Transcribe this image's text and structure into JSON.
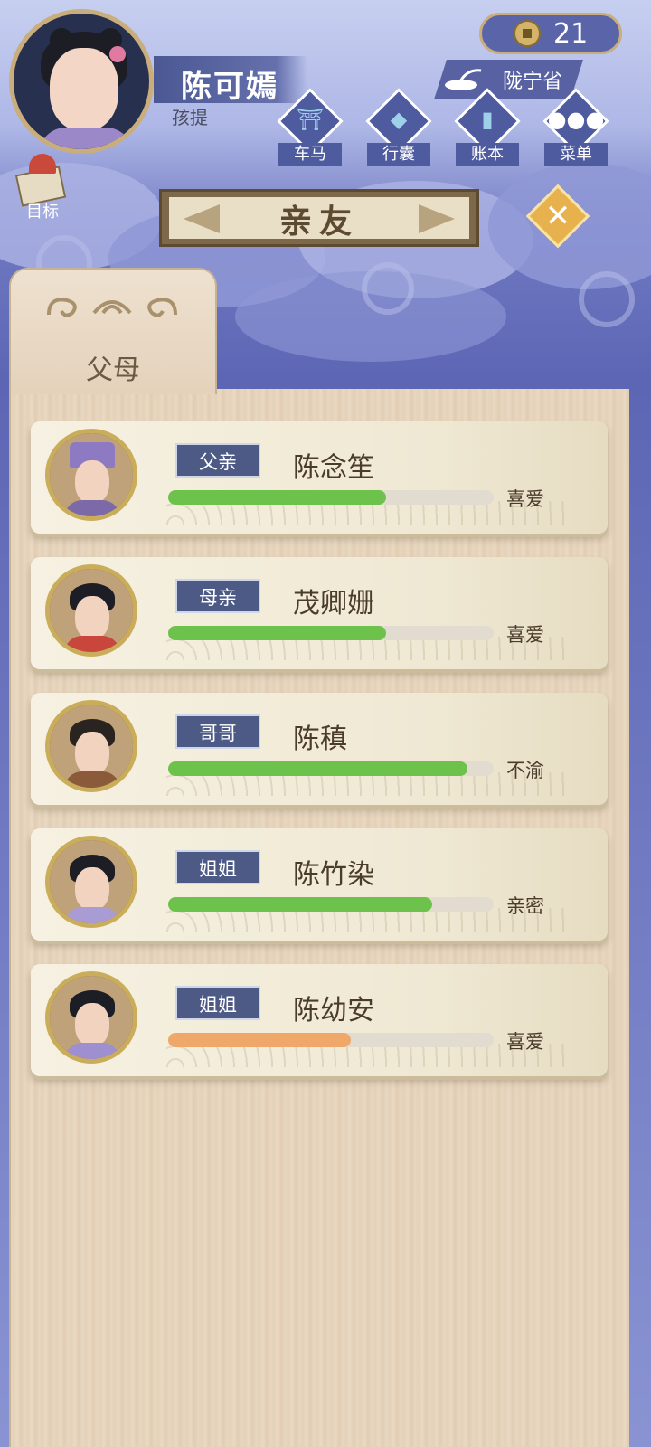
{
  "player": {
    "name": "陈可嫣",
    "title": "孩提"
  },
  "coins": "21",
  "location": "陇宁省",
  "nav": [
    {
      "label": "车马",
      "icon": "carriage-icon"
    },
    {
      "label": "行囊",
      "icon": "bag-icon"
    },
    {
      "label": "账本",
      "icon": "ledger-icon"
    },
    {
      "label": "菜单",
      "icon": "menu-dots-icon"
    }
  ],
  "goal_label": "目标",
  "page_title": "亲友",
  "tab_label": "父母",
  "colors": {
    "bar_green": "#6cc24a",
    "bar_orange": "#f0a86a",
    "relation_tag": "#4d5a86"
  },
  "relatives": [
    {
      "relation": "父亲",
      "name": "陈念笙",
      "mood": "喜爱",
      "affinity": 0.67,
      "bar": "green"
    },
    {
      "relation": "母亲",
      "name": "茂卿姗",
      "mood": "喜爱",
      "affinity": 0.67,
      "bar": "green"
    },
    {
      "relation": "哥哥",
      "name": "陈稹",
      "mood": "不渝",
      "affinity": 0.92,
      "bar": "green"
    },
    {
      "relation": "姐姐",
      "name": "陈竹染",
      "mood": "亲密",
      "affinity": 0.81,
      "bar": "green"
    },
    {
      "relation": "姐姐",
      "name": "陈幼安",
      "mood": "喜爱",
      "affinity": 0.56,
      "bar": "orange"
    }
  ]
}
